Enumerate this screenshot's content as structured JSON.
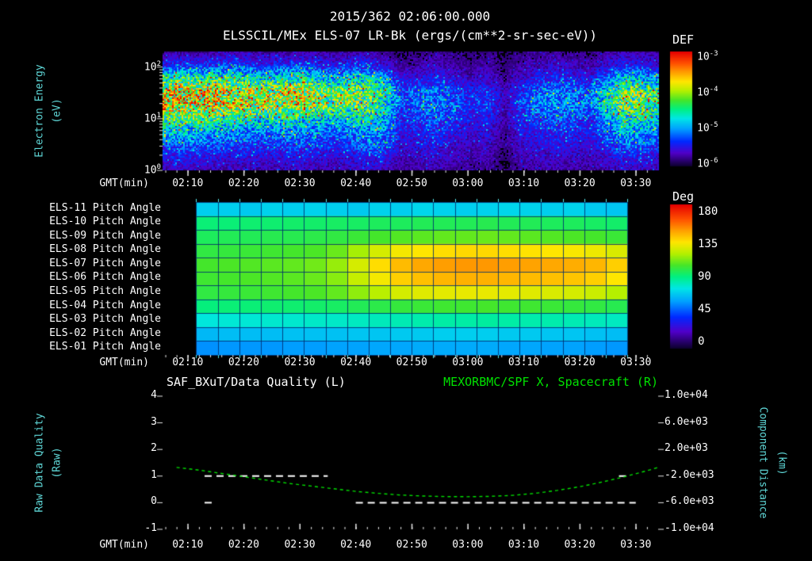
{
  "title": "2015/362 02:06:00.000",
  "subtitle": "ELSSCIL/MEx ELS-07 LR-Bk (ergs/(cm**2-sr-sec-eV))",
  "colors": {
    "background": "#000000",
    "cyan_label": "#5fd7d7",
    "green_series": "#00e000",
    "white_text": "#ffffff"
  },
  "axis": {
    "gmt_label": "GMT(min)",
    "time_ticks": [
      "02:10",
      "02:20",
      "02:30",
      "02:40",
      "02:50",
      "03:00",
      "03:10",
      "03:20",
      "03:30"
    ]
  },
  "spectrogram_panel": {
    "ylabel_line1": "Electron Energy",
    "ylabel_line2": "(eV)",
    "ytick_labels": [
      "10^2",
      "10^1",
      "10^0"
    ],
    "colorbar_title": "DEF",
    "colorbar_ticks": [
      "10^-3",
      "10^-4",
      "10^-5",
      "10^-6"
    ]
  },
  "pitch_panel": {
    "row_labels": [
      "ELS-11 Pitch Angle",
      "ELS-10 Pitch Angle",
      "ELS-09 Pitch Angle",
      "ELS-08 Pitch Angle",
      "ELS-07 Pitch Angle",
      "ELS-06 Pitch Angle",
      "ELS-05 Pitch Angle",
      "ELS-04 Pitch Angle",
      "ELS-03 Pitch Angle",
      "ELS-02 Pitch Angle",
      "ELS-01 Pitch Angle"
    ],
    "colorbar_title": "Deg",
    "colorbar_ticks": [
      "180",
      "135",
      "90",
      "45",
      "0"
    ]
  },
  "bottom_panel": {
    "left_title": "SAF_BXuT/Data Quality (L)",
    "right_title": "MEXORBMC/SPF X, Spacecraft (R)",
    "left_ylabel_line1": "Raw Data Quality",
    "left_ylabel_line2": "(Raw)",
    "right_ylabel_line1": "Component Distance",
    "right_ylabel_line2": "(km)",
    "left_ticks": [
      "4",
      "3",
      "2",
      "1",
      "0",
      "-1"
    ],
    "right_ticks": [
      "1.0e+04",
      "6.0e+03",
      "2.0e+03",
      "-2.0e+03",
      "-6.0e+03",
      "-1.0e+04"
    ]
  },
  "chart_data": [
    {
      "type": "heatmap",
      "name": "electron-energy-spectrogram",
      "title": "ELSSCIL/MEx ELS-07 LR-Bk",
      "units": "ergs/(cm**2-sr-sec-eV)",
      "x_time_start": "02:06",
      "x_time_end": "03:34",
      "column_times": [
        "02:07",
        "02:10",
        "02:13",
        "02:16",
        "02:19",
        "02:22",
        "02:25",
        "02:28",
        "02:31",
        "02:34",
        "02:37",
        "02:40",
        "02:42",
        "02:45",
        "02:48",
        "02:51",
        "02:54",
        "02:57",
        "03:00",
        "03:03",
        "03:06",
        "03:09",
        "03:12",
        "03:15",
        "03:18",
        "03:21",
        "03:24",
        "03:27",
        "03:30",
        "03:33"
      ],
      "row_energies_ev": [
        150,
        80,
        45,
        25,
        15,
        8,
        5,
        3,
        1.8,
        1
      ],
      "y_scale": "log",
      "ylim_ev": [
        1,
        200
      ],
      "colorbar": {
        "label": "DEF",
        "min": 1e-06,
        "max": 0.001,
        "scale": "log"
      },
      "values_norm_meaning": "normalized log flux: 0 = 1e-6, 1 = 1e-3 ergs/(cm**2-sr-sec-eV)",
      "values_norm": [
        [
          0.08,
          0.1,
          0.09,
          0.1,
          0.12,
          0.1,
          0.09,
          0.1,
          0.11,
          0.1,
          0.09,
          0.1,
          0.12,
          0.08,
          0.06,
          0.07,
          0.08,
          0.07,
          0.06,
          0.08,
          0.05,
          0.07,
          0.08,
          0.09,
          0.08,
          0.07,
          0.1,
          0.12,
          0.1,
          0.09
        ],
        [
          0.2,
          0.25,
          0.22,
          0.24,
          0.26,
          0.22,
          0.2,
          0.22,
          0.24,
          0.2,
          0.18,
          0.2,
          0.22,
          0.15,
          0.08,
          0.1,
          0.12,
          0.1,
          0.08,
          0.1,
          0.06,
          0.1,
          0.12,
          0.14,
          0.12,
          0.1,
          0.15,
          0.2,
          0.18,
          0.15
        ],
        [
          0.5,
          0.55,
          0.52,
          0.54,
          0.5,
          0.48,
          0.45,
          0.48,
          0.5,
          0.45,
          0.4,
          0.42,
          0.45,
          0.35,
          0.15,
          0.18,
          0.2,
          0.15,
          0.12,
          0.15,
          0.08,
          0.15,
          0.2,
          0.22,
          0.2,
          0.18,
          0.3,
          0.45,
          0.42,
          0.35
        ],
        [
          0.72,
          0.78,
          0.75,
          0.76,
          0.72,
          0.7,
          0.68,
          0.7,
          0.72,
          0.65,
          0.6,
          0.62,
          0.6,
          0.5,
          0.25,
          0.28,
          0.3,
          0.25,
          0.2,
          0.22,
          0.12,
          0.22,
          0.3,
          0.32,
          0.3,
          0.28,
          0.45,
          0.62,
          0.6,
          0.5
        ],
        [
          0.75,
          0.8,
          0.77,
          0.75,
          0.72,
          0.7,
          0.68,
          0.7,
          0.7,
          0.64,
          0.6,
          0.62,
          0.58,
          0.48,
          0.25,
          0.3,
          0.32,
          0.28,
          0.22,
          0.25,
          0.12,
          0.25,
          0.32,
          0.35,
          0.32,
          0.3,
          0.48,
          0.65,
          0.62,
          0.52
        ],
        [
          0.55,
          0.6,
          0.58,
          0.56,
          0.52,
          0.5,
          0.48,
          0.5,
          0.5,
          0.45,
          0.42,
          0.45,
          0.48,
          0.4,
          0.2,
          0.25,
          0.28,
          0.22,
          0.18,
          0.2,
          0.1,
          0.2,
          0.25,
          0.28,
          0.25,
          0.22,
          0.35,
          0.5,
          0.48,
          0.4
        ],
        [
          0.4,
          0.42,
          0.4,
          0.38,
          0.36,
          0.35,
          0.33,
          0.35,
          0.36,
          0.32,
          0.3,
          0.33,
          0.38,
          0.32,
          0.18,
          0.2,
          0.22,
          0.18,
          0.15,
          0.17,
          0.08,
          0.17,
          0.2,
          0.22,
          0.2,
          0.18,
          0.28,
          0.4,
          0.38,
          0.32
        ],
        [
          0.28,
          0.3,
          0.28,
          0.27,
          0.25,
          0.25,
          0.23,
          0.25,
          0.26,
          0.23,
          0.22,
          0.25,
          0.3,
          0.26,
          0.15,
          0.17,
          0.18,
          0.15,
          0.12,
          0.14,
          0.07,
          0.14,
          0.17,
          0.18,
          0.17,
          0.15,
          0.22,
          0.3,
          0.28,
          0.25
        ],
        [
          0.18,
          0.2,
          0.19,
          0.18,
          0.17,
          0.17,
          0.16,
          0.17,
          0.18,
          0.16,
          0.15,
          0.17,
          0.2,
          0.18,
          0.12,
          0.13,
          0.14,
          0.12,
          0.1,
          0.11,
          0.06,
          0.11,
          0.13,
          0.14,
          0.13,
          0.12,
          0.16,
          0.2,
          0.19,
          0.17
        ],
        [
          0.12,
          0.14,
          0.13,
          0.12,
          0.12,
          0.11,
          0.11,
          0.12,
          0.12,
          0.11,
          0.1,
          0.12,
          0.14,
          0.12,
          0.09,
          0.1,
          0.1,
          0.09,
          0.08,
          0.09,
          0.05,
          0.09,
          0.1,
          0.1,
          0.1,
          0.09,
          0.11,
          0.14,
          0.13,
          0.12
        ]
      ]
    },
    {
      "type": "heatmap",
      "name": "pitch-angle-by-sensor",
      "row_labels": [
        "ELS-11",
        "ELS-10",
        "ELS-09",
        "ELS-08",
        "ELS-07",
        "ELS-06",
        "ELS-05",
        "ELS-04",
        "ELS-03",
        "ELS-02",
        "ELS-01"
      ],
      "x_time_start": "02:12",
      "x_time_end": "03:29",
      "n_columns": 20,
      "colorbar": {
        "label": "Deg",
        "min": 0,
        "max": 180
      },
      "values_deg": [
        [
          70,
          70,
          69,
          71,
          70,
          71,
          70,
          69,
          71,
          70,
          72,
          71,
          70,
          71,
          72,
          71,
          70,
          71,
          69,
          68
        ],
        [
          92,
          92,
          93,
          93,
          94,
          94,
          95,
          95,
          96,
          96,
          97,
          97,
          97,
          98,
          97,
          97,
          96,
          96,
          95,
          94
        ],
        [
          96,
          97,
          97,
          98,
          98,
          99,
          100,
          102,
          104,
          106,
          107,
          108,
          108,
          109,
          108,
          107,
          106,
          105,
          104,
          102
        ],
        [
          100,
          101,
          102,
          103,
          104,
          105,
          109,
          117,
          125,
          131,
          133,
          135,
          136,
          136,
          135,
          134,
          133,
          132,
          130,
          126
        ],
        [
          104,
          105,
          106,
          107,
          108,
          110,
          115,
          125,
          135,
          142,
          146,
          148,
          149,
          149,
          148,
          147,
          146,
          145,
          143,
          138
        ],
        [
          103,
          104,
          105,
          106,
          107,
          109,
          113,
          122,
          131,
          138,
          141,
          143,
          144,
          144,
          143,
          142,
          141,
          140,
          138,
          133
        ],
        [
          100,
          101,
          102,
          103,
          104,
          105,
          108,
          114,
          120,
          125,
          127,
          128,
          129,
          129,
          128,
          127,
          126,
          125,
          123,
          119
        ],
        [
          91,
          92,
          92,
          93,
          93,
          94,
          95,
          97,
          99,
          101,
          102,
          103,
          103,
          104,
          103,
          103,
          102,
          101,
          100,
          98
        ],
        [
          77,
          78,
          78,
          79,
          79,
          80,
          80,
          81,
          82,
          83,
          84,
          85,
          85,
          86,
          85,
          84,
          84,
          83,
          82,
          81
        ],
        [
          65,
          66,
          66,
          66,
          67,
          67,
          67,
          68,
          68,
          69,
          69,
          70,
          70,
          70,
          69,
          69,
          68,
          68,
          67,
          66
        ],
        [
          57,
          58,
          58,
          58,
          59,
          59,
          60,
          60,
          61,
          61,
          62,
          62,
          62,
          62,
          61,
          61,
          60,
          60,
          59,
          58
        ]
      ]
    },
    {
      "type": "line",
      "name": "quality-and-spacecraft-x",
      "left_axis": {
        "label": "Raw Data Quality (Raw)",
        "min": -1,
        "max": 4,
        "ticks": [
          4,
          3,
          2,
          1,
          0,
          -1
        ]
      },
      "right_axis": {
        "label": "Component Distance (km)",
        "min": -10000,
        "max": 10000,
        "ticks": [
          10000,
          6000,
          2000,
          -2000,
          -6000,
          -10000
        ]
      },
      "series": [
        {
          "name": "SAF_BXuT/Data Quality (L)",
          "axis": "left",
          "color": "#ffffff",
          "style": "dashed",
          "segments": [
            {
              "start": "02:13",
              "end": "02:35",
              "value": 1
            },
            {
              "start": "02:13",
              "end": "02:15",
              "value": 0
            },
            {
              "start": "02:40",
              "end": "03:30",
              "value": 0
            },
            {
              "start": "03:27",
              "end": "03:29",
              "value": 1
            }
          ]
        },
        {
          "name": "MEXORBMC/SPF X, Spacecraft (R)",
          "axis": "right",
          "color": "#00e000",
          "style": "dashed",
          "x": [
            "02:08",
            "02:12",
            "02:16",
            "02:20",
            "02:24",
            "02:28",
            "02:32",
            "02:36",
            "02:40",
            "02:44",
            "02:48",
            "02:52",
            "02:56",
            "03:00",
            "03:04",
            "03:08",
            "03:12",
            "03:16",
            "03:20",
            "03:24",
            "03:28",
            "03:32",
            "03:34"
          ],
          "y_km": [
            -700,
            -1100,
            -1600,
            -2100,
            -2600,
            -3100,
            -3500,
            -3900,
            -4300,
            -4600,
            -4850,
            -5000,
            -5080,
            -5100,
            -5050,
            -4900,
            -4600,
            -4150,
            -3600,
            -2900,
            -2100,
            -1200,
            -700
          ]
        }
      ]
    }
  ]
}
